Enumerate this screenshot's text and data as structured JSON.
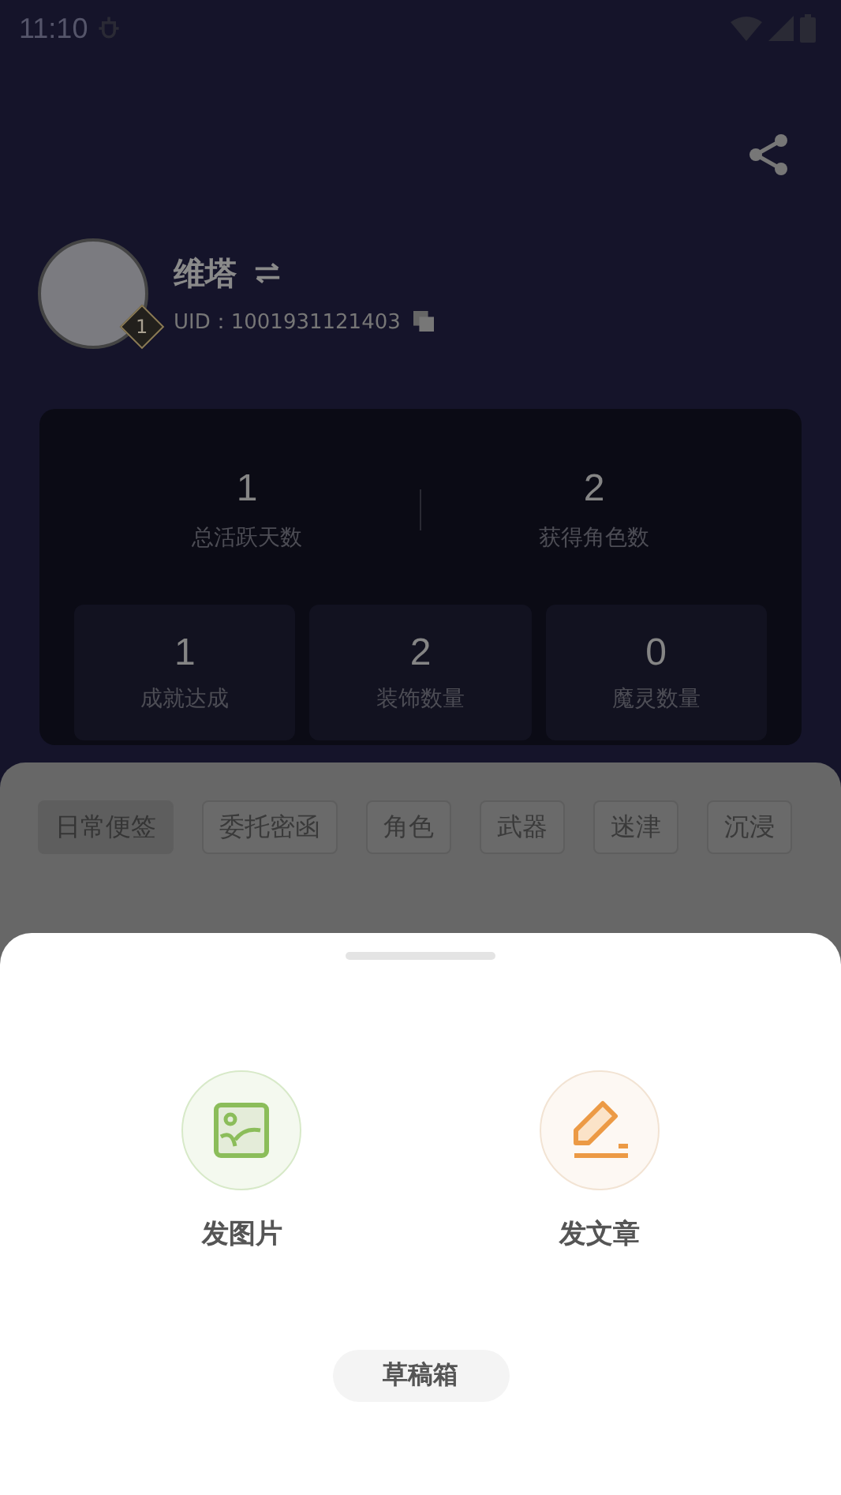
{
  "status_bar": {
    "time": "11:10"
  },
  "profile": {
    "name": "维塔",
    "uid": "UID：1001931121403",
    "level": "1"
  },
  "stats_primary": [
    {
      "value": "1",
      "label": "总活跃天数"
    },
    {
      "value": "2",
      "label": "获得角色数"
    }
  ],
  "stats_secondary": [
    {
      "value": "1",
      "label": "成就达成"
    },
    {
      "value": "2",
      "label": "装饰数量"
    },
    {
      "value": "0",
      "label": "魔灵数量"
    }
  ],
  "tabs": [
    {
      "label": "日常便签",
      "selected": true
    },
    {
      "label": "委托密函",
      "selected": false
    },
    {
      "label": "角色",
      "selected": false
    },
    {
      "label": "武器",
      "selected": false
    },
    {
      "label": "迷津",
      "selected": false
    },
    {
      "label": "沉浸",
      "selected": false
    }
  ],
  "sheet": {
    "actions": [
      {
        "kind": "image",
        "label": "发图片"
      },
      {
        "kind": "article",
        "label": "发文章"
      }
    ],
    "drafts_button": "草稿箱"
  }
}
